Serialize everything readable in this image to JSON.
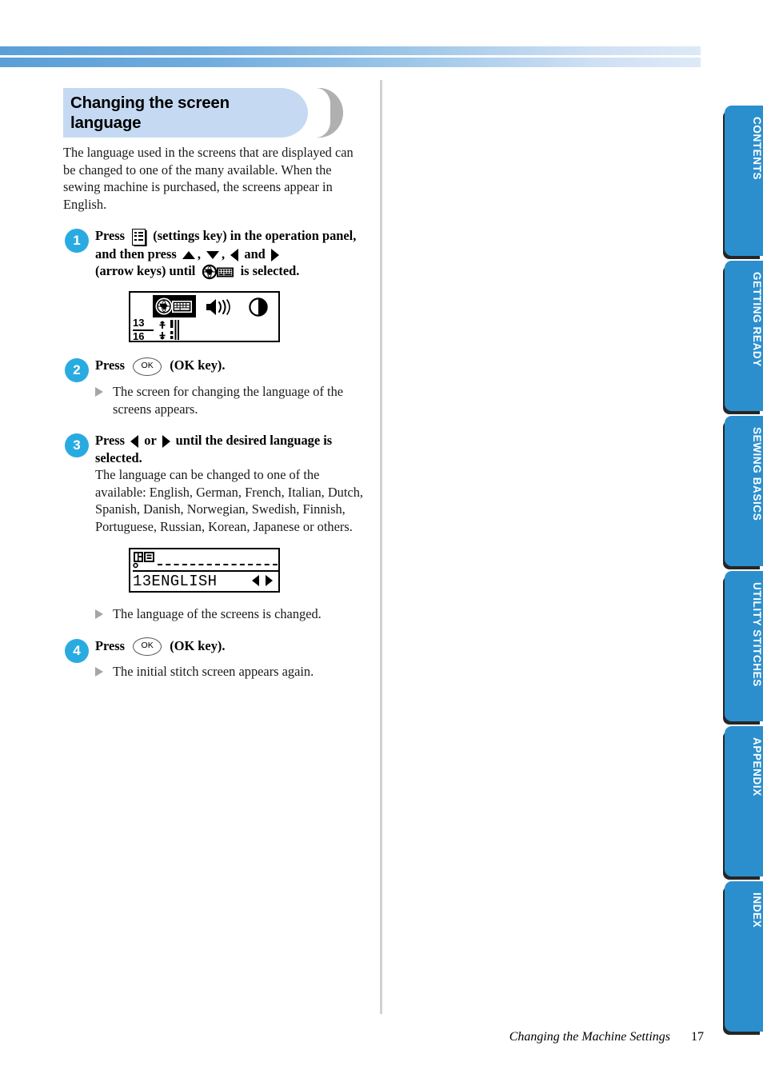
{
  "page": {
    "footer_title": "Changing the Machine Settings",
    "page_number": "17"
  },
  "section": {
    "title_line1": "Changing the screen",
    "title_line2": "language",
    "intro": "The language used in the screens that are displayed can be changed to one of the many available. When the sewing machine is purchased, the screens appear in English."
  },
  "steps": [
    {
      "number": "1",
      "head_part1": "Press",
      "icon1": "settings-key-icon",
      "head_part2": "(settings key) in the operation panel, and then press",
      "arrow_up": "up-arrow-icon",
      "arrow_down": "down-arrow-icon",
      "arrow_left": "left-arrow-icon",
      "arrow_right": "right-arrow-icon",
      "head_part3": "and",
      "head_part4": "(arrow keys) until",
      "icon2": "globe-keyboard-icon",
      "head_part5": "is selected.",
      "comma": ",",
      "lcd": {
        "selected_icon": "globe-keyboard-icon",
        "speaker_icon": "speaker-volume-icon",
        "contrast_icon": "contrast-icon",
        "num_top": "13",
        "num_bottom": "16"
      }
    },
    {
      "number": "2",
      "head_part1": "Press",
      "ok_label": "OK",
      "head_part2": "(OK key).",
      "result": "The screen for changing the language of the screens appears."
    },
    {
      "number": "3",
      "head_part1": "Press",
      "head_or": "or",
      "head_part2": "until the desired language is selected.",
      "body": "The language can be changed to one of the available: English, German, French, Italian, Dutch, Spanish, Danish, Norwegian, Swedish, Finnish, Portuguese, Russian, Korean, Japanese or others.",
      "lcd": {
        "language_icon": "language-select-icon",
        "number": "13",
        "language": "ENGLISH",
        "left_arrow": "left-arrow-icon",
        "right_arrow": "right-arrow-icon"
      },
      "result": "The language of the screens is changed."
    },
    {
      "number": "4",
      "head_part1": "Press",
      "ok_label": "OK",
      "head_part2": "(OK key).",
      "result": "The initial stitch screen appears again."
    }
  ],
  "tabs": [
    {
      "label": "CONTENTS"
    },
    {
      "label": "GETTING READY"
    },
    {
      "label": "SEWING BASICS"
    },
    {
      "label": "UTILITY STITCHES"
    },
    {
      "label": "APPENDIX"
    },
    {
      "label": "INDEX"
    }
  ],
  "colors": {
    "tab_blue": "#2b8fce",
    "step_circle_blue": "#29abe2",
    "title_bar_blue": "#c5daf2",
    "banner_blue": "#5a9fd8"
  }
}
